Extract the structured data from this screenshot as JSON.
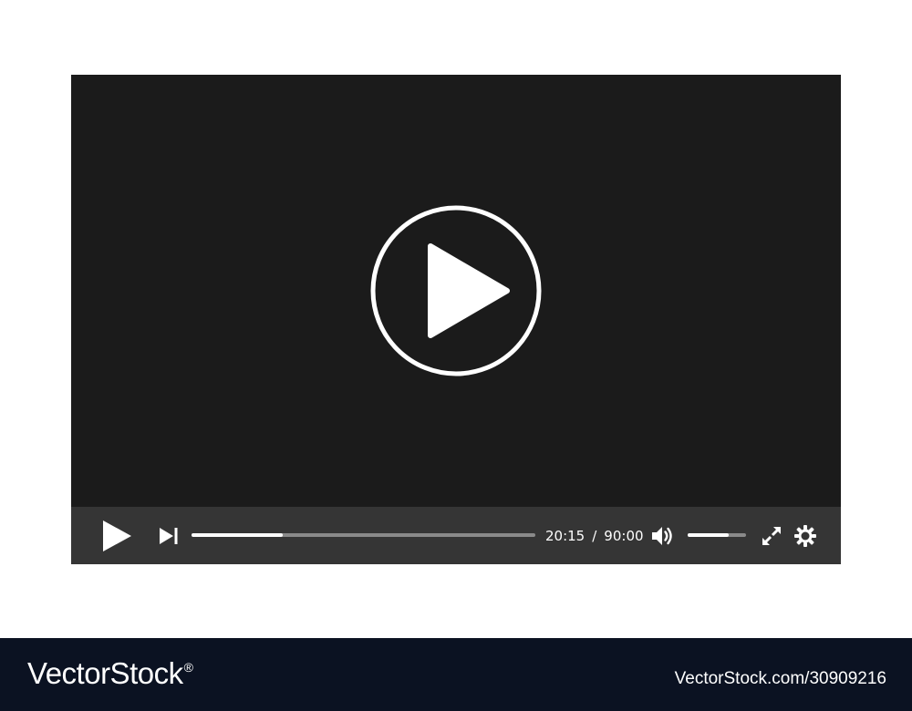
{
  "player": {
    "time": {
      "current": "20:15",
      "separator": "/",
      "total": "90:00"
    },
    "progress_fraction": 0.265,
    "volume_fraction": 0.7,
    "icons": {
      "big_play": "play-circle-icon",
      "play": "play-icon",
      "next": "skip-next-icon",
      "volume": "volume-icon",
      "fullscreen": "fullscreen-icon",
      "settings": "gear-icon"
    },
    "colors": {
      "video_background": "#1b1b1b",
      "control_bar": "#353535",
      "foreground": "#ffffff",
      "track": "#8a8a8a"
    }
  },
  "footer": {
    "brand": "VectorStock",
    "registered_mark": "®",
    "image_id": "VectorStock.com/30909216",
    "background": "#0b1222"
  }
}
